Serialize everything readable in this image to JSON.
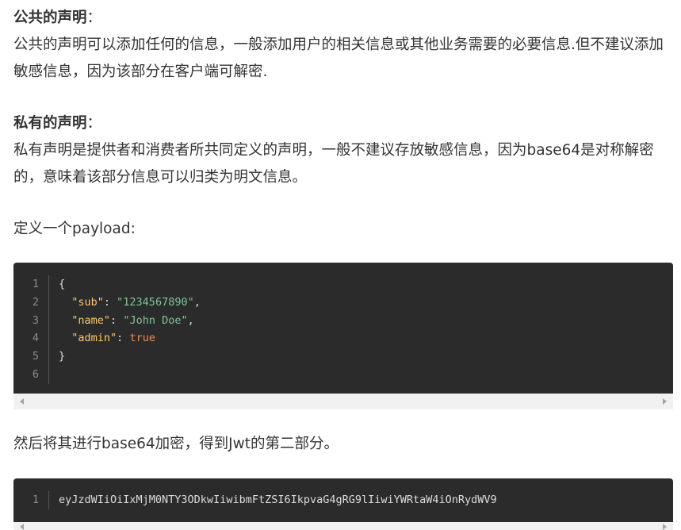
{
  "sections": {
    "public": {
      "heading": "公共的声明",
      "colon": "：",
      "body": "公共的声明可以添加任何的信息，一般添加用户的相关信息或其他业务需要的必要信息.但不建议添加敏感信息，因为该部分在客户端可解密."
    },
    "private": {
      "heading": "私有的声明",
      "colon": "：",
      "body": "私有声明是提供者和消费者所共同定义的声明，一般不建议存放敏感信息，因为base64是对称解密的，意味着该部分信息可以归类为明文信息。"
    },
    "define_payload": "定义一个payload:",
    "then_encode": "然后将其进行base64加密，得到Jwt的第二部分。"
  },
  "code_block_1": {
    "line_numbers": [
      "1",
      "2",
      "3",
      "4",
      "5",
      "6"
    ],
    "open_brace": "{",
    "close_brace": "}",
    "fields": [
      {
        "key": "\"sub\"",
        "value": "\"1234567890\"",
        "trail": ","
      },
      {
        "key": "\"name\"",
        "value": "\"John Doe\"",
        "trail": ","
      },
      {
        "key": "\"admin\"",
        "value": "true",
        "trail": ""
      }
    ],
    "colon": ": "
  },
  "code_block_2": {
    "line_numbers": [
      "1"
    ],
    "text": "eyJzdWIiOiIxMjM0NTY3ODkwIiwibmFtZSI6IkpvaG4gRG9lIiwiYWRtaW4iOnRydWV9"
  },
  "colors": {
    "code_bg": "#2b2b2b",
    "key": "#ffc66d",
    "string": "#7ec699",
    "boolean": "#f08d49",
    "text": "#333333"
  }
}
